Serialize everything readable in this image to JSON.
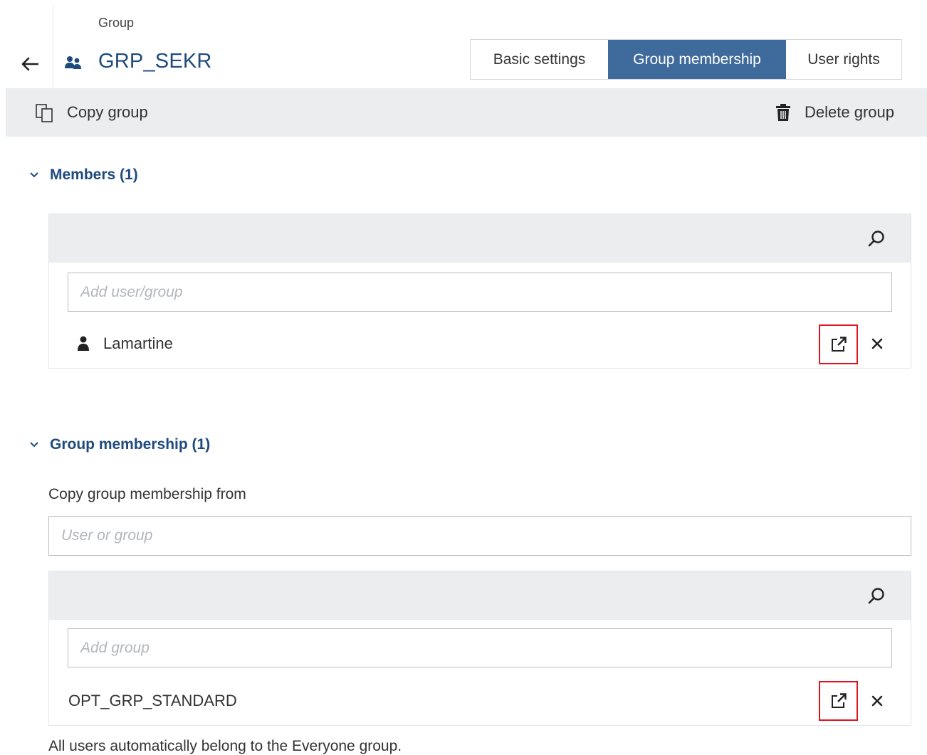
{
  "header": {
    "object_type": "Group",
    "group_name": "GRP_SEKR",
    "tabs": [
      {
        "label": "Basic settings"
      },
      {
        "label": "Group membership"
      },
      {
        "label": "User rights"
      }
    ],
    "active_tab": "Group membership"
  },
  "toolbar": {
    "copy_label": "Copy group",
    "delete_label": "Delete group"
  },
  "members": {
    "title": "Members (1)",
    "add_placeholder": "Add user/group",
    "items": [
      {
        "name": "Lamartine",
        "icon": "user-icon"
      }
    ]
  },
  "group_membership": {
    "title": "Group membership (1)",
    "copy_from_label": "Copy group membership from",
    "copy_from_placeholder": "User or group",
    "add_placeholder": "Add group",
    "items": [
      {
        "name": "OPT_GRP_STANDARD"
      }
    ],
    "footnote": "All users automatically belong to the Everyone group."
  },
  "colors": {
    "accent": "#3f6b9c",
    "title_blue": "#1e4a7c",
    "highlight_red": "#e0141e",
    "toolbar_bg": "#ebedef"
  }
}
